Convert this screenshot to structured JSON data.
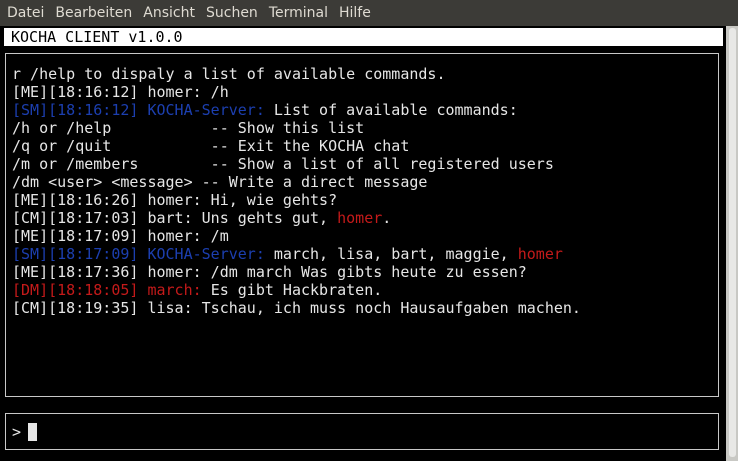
{
  "menubar": {
    "items": [
      "Datei",
      "Bearbeiten",
      "Ansicht",
      "Suchen",
      "Terminal",
      "Hilfe"
    ]
  },
  "app": {
    "title": "KOCHA CLIENT v1.0.0"
  },
  "colors": {
    "default": "#e6e6e6",
    "server": "#1c3fb0",
    "highlight": "#c41a1a"
  },
  "chat": {
    "lines": [
      [
        {
          "t": "r /help to dispaly a list of available commands.",
          "c": "default"
        }
      ],
      [
        {
          "t": "[ME][18:16:12] homer: /h",
          "c": "default"
        }
      ],
      [
        {
          "t": "[SM][18:16:12] KOCHA-Server: ",
          "c": "server"
        },
        {
          "t": "List of available commands:",
          "c": "default"
        }
      ],
      [
        {
          "t": "/h or /help           -- Show this list",
          "c": "default"
        }
      ],
      [
        {
          "t": "/q or /quit           -- Exit the KOCHA chat",
          "c": "default"
        }
      ],
      [
        {
          "t": "/m or /members        -- Show a list of all registered users",
          "c": "default"
        }
      ],
      [
        {
          "t": "/dm <user> <message> -- Write a direct message",
          "c": "default"
        }
      ],
      [
        {
          "t": "[ME][18:16:26] homer: Hi, wie gehts?",
          "c": "default"
        }
      ],
      [
        {
          "t": "[CM][18:17:03] bart: Uns gehts gut, ",
          "c": "default"
        },
        {
          "t": "homer",
          "c": "highlight"
        },
        {
          "t": ".",
          "c": "default"
        }
      ],
      [
        {
          "t": "[ME][18:17:09] homer: /m",
          "c": "default"
        }
      ],
      [
        {
          "t": "[SM][18:17:09] KOCHA-Server: ",
          "c": "server"
        },
        {
          "t": "march, lisa, bart, maggie, ",
          "c": "default"
        },
        {
          "t": "homer",
          "c": "highlight"
        }
      ],
      [
        {
          "t": "[ME][18:17:36] homer: /dm march Was gibts heute zu essen?",
          "c": "default"
        }
      ],
      [
        {
          "t": "[DM][18:18:05] march: ",
          "c": "highlight"
        },
        {
          "t": "Es gibt Hackbraten.",
          "c": "default"
        }
      ],
      [
        {
          "t": "[CM][18:19:35] lisa: Tschau, ich muss noch Hausaufgaben machen.",
          "c": "default"
        }
      ]
    ]
  },
  "input": {
    "prompt": ">",
    "value": ""
  }
}
